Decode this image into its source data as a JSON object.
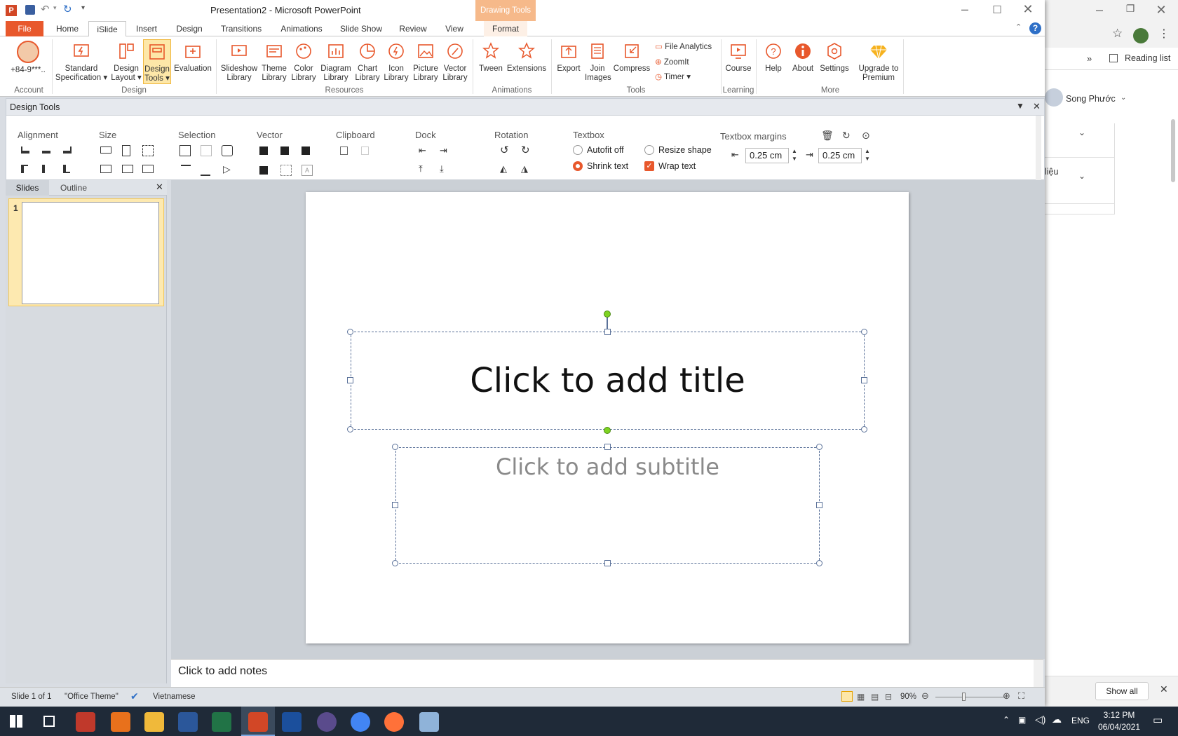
{
  "window": {
    "title": "Presentation2 - Microsoft PowerPoint",
    "contextual_tab_group": "Drawing Tools"
  },
  "tabs": [
    "File",
    "Home",
    "iSlide",
    "Insert",
    "Design",
    "Transitions",
    "Animations",
    "Slide Show",
    "Review",
    "View",
    "Format"
  ],
  "ribbon": {
    "account": {
      "label": "+84-9***..",
      "group": "Account"
    },
    "design": {
      "group": "Design",
      "items": [
        "Standard Specification",
        "Design Layout",
        "Design Tools",
        "Evaluation"
      ]
    },
    "resources": {
      "group": "Resources",
      "items": [
        "Slideshow Library",
        "Theme Library",
        "Color Library",
        "Diagram Library",
        "Chart Library",
        "Icon Library",
        "Picture Library",
        "Vector Library"
      ]
    },
    "animations": {
      "group": "Animations",
      "items": [
        "Tween",
        "Extensions"
      ]
    },
    "tools": {
      "group": "Tools",
      "items": [
        "Export",
        "Join Images",
        "Compress"
      ],
      "small": [
        "File Analytics",
        "ZoomIt",
        "Timer"
      ]
    },
    "learning": {
      "group": "Learning",
      "items": [
        "Course"
      ]
    },
    "more": {
      "group": "More",
      "items": [
        "Help",
        "About",
        "Settings",
        "Upgrade to Premium"
      ]
    }
  },
  "design_tools": {
    "title": "Design Tools",
    "groups": [
      "Alignment",
      "Size",
      "Selection",
      "Vector",
      "Clipboard",
      "Dock",
      "Rotation"
    ],
    "textbox": {
      "label": "Textbox",
      "options": [
        "Autofit off",
        "Shrink text",
        "Resize shape",
        "Wrap text"
      ],
      "selected": "Shrink text",
      "wrap_checked": true
    },
    "margins": {
      "label": "Textbox margins",
      "left": "0.25 cm",
      "right": "0.25 cm"
    }
  },
  "left_panel": {
    "tabs": [
      "Slides",
      "Outline"
    ],
    "slide_number": "1"
  },
  "slide": {
    "title_placeholder": "Click to add title",
    "subtitle_placeholder": "Click to add subtitle"
  },
  "notes": {
    "placeholder": "Click to add notes"
  },
  "status": {
    "slide": "Slide 1 of 1",
    "theme": "\"Office Theme\"",
    "language": "Vietnamese",
    "zoom": "90%"
  },
  "browser": {
    "reading_list": "Reading list",
    "user": "Song Phước",
    "partial_text": "liệu",
    "show_all": "Show all"
  },
  "taskbar": {
    "time": "3:12 PM",
    "date": "06/04/2021",
    "lang": "ENG"
  }
}
